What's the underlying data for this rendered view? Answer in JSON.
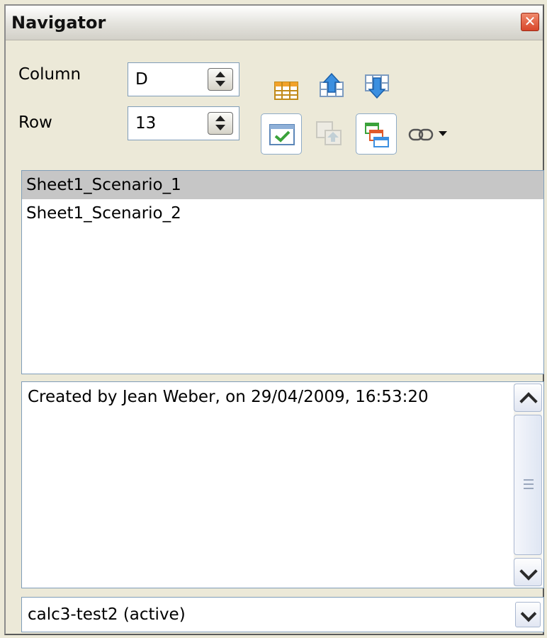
{
  "window": {
    "title": "Navigator",
    "close_icon": "close-icon"
  },
  "fields": {
    "column_label": "Column",
    "column_value": "D",
    "row_label": "Row",
    "row_value": "13"
  },
  "toolbar": {
    "icons": [
      "data-range-icon",
      "start-icon",
      "end-icon",
      "contents-icon",
      "toggle-icon",
      "scenarios-icon",
      "drag-mode-link-icon",
      "drag-mode-dropdown-icon"
    ]
  },
  "scenarios": {
    "items": [
      {
        "label": "Sheet1_Scenario_1",
        "selected": true
      },
      {
        "label": "Sheet1_Scenario_2",
        "selected": false
      }
    ]
  },
  "description": {
    "text": "Created by Jean Weber, on 29/04/2009, 16:53:20"
  },
  "document_select": {
    "value": "calc3-test2 (active)"
  },
  "colors": {
    "selection": "#c6c6c6",
    "close_button": "#d8462a",
    "icon_blue": "#3b8fe0",
    "icon_orange": "#f2a22a"
  }
}
